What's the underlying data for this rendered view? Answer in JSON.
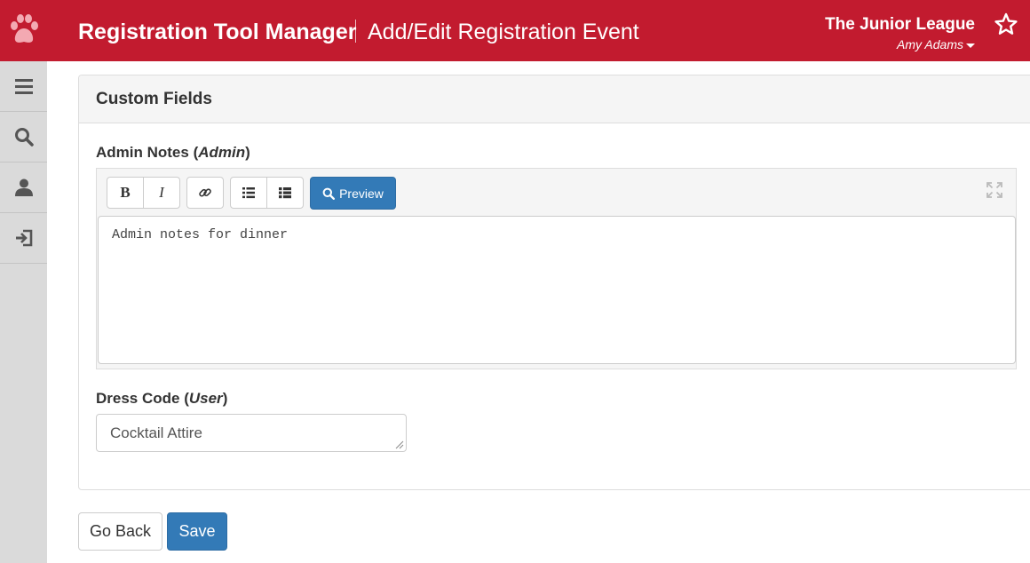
{
  "header": {
    "app_title": "Registration Tool Manager",
    "page_title": "Add/Edit Registration Event",
    "org_name": "The Junior League",
    "user_name": "Amy Adams",
    "brand_color": "#c21b2f",
    "icons": {
      "logo": "paw-icon",
      "favorite": "star-icon",
      "user_menu": "caret-down-icon"
    }
  },
  "sidebar": {
    "items": [
      {
        "name": "menu",
        "icon": "hamburger-icon"
      },
      {
        "name": "search",
        "icon": "search-icon"
      },
      {
        "name": "profile",
        "icon": "user-icon"
      },
      {
        "name": "logout",
        "icon": "sign-out-icon"
      }
    ]
  },
  "panel": {
    "heading": "Custom Fields",
    "admin_notes": {
      "label": "Admin Notes",
      "scope": "Admin",
      "value": "Admin notes for dinner",
      "toolbar": {
        "bold": "B",
        "italic": "I",
        "link_icon": "link-icon",
        "unordered_list_icon": "list-ul-icon",
        "ordered_list_icon": "list-ol-icon",
        "preview_label": "Preview",
        "preview_icon": "search-icon",
        "fullscreen_icon": "fullscreen-icon"
      }
    },
    "dress_code": {
      "label": "Dress Code",
      "scope": "User",
      "value": "Cocktail Attire"
    }
  },
  "actions": {
    "back_label": "Go Back",
    "save_label": "Save",
    "primary_color": "#337ab7"
  }
}
